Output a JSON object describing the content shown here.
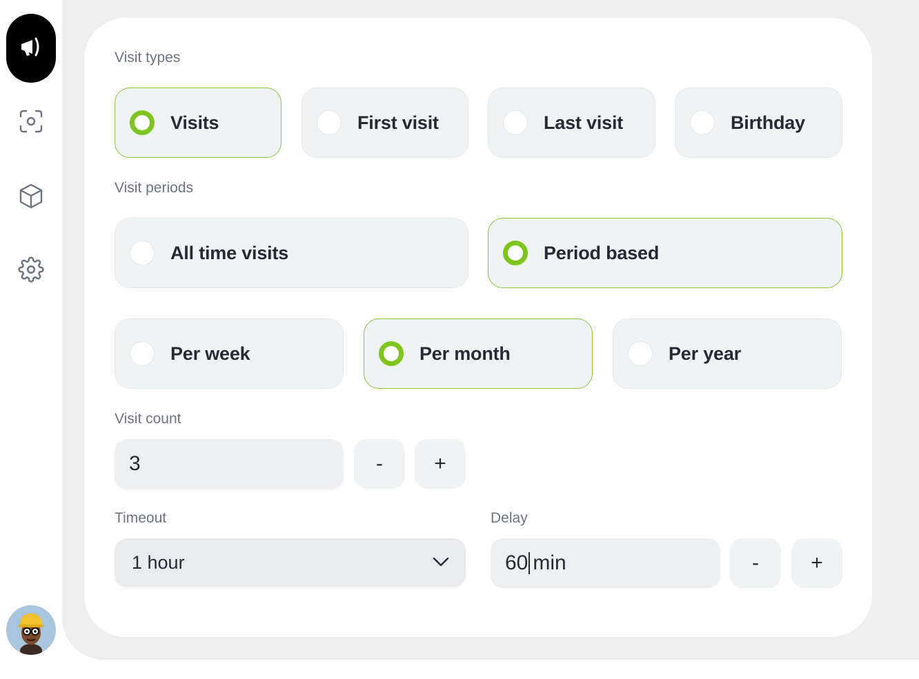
{
  "sidebar": {
    "logo_icon": "megaphone-icon",
    "nav": [
      {
        "icon": "scan-icon"
      },
      {
        "icon": "cube-icon"
      },
      {
        "icon": "gear-icon"
      }
    ],
    "avatar_icon": "user-avatar"
  },
  "visit_types": {
    "label": "Visit types",
    "options": [
      {
        "label": "Visits",
        "selected": true
      },
      {
        "label": "First visit",
        "selected": false
      },
      {
        "label": "Last visit",
        "selected": false
      },
      {
        "label": "Birthday",
        "selected": false
      }
    ]
  },
  "visit_periods": {
    "label": "Visit periods",
    "options": [
      {
        "label": "All time visits",
        "selected": false
      },
      {
        "label": "Period based",
        "selected": true
      }
    ],
    "sub_options": [
      {
        "label": "Per week",
        "selected": false
      },
      {
        "label": "Per month",
        "selected": true
      },
      {
        "label": "Per year",
        "selected": false
      }
    ]
  },
  "visit_count": {
    "label": "Visit count",
    "value": "3",
    "decrement_label": "-",
    "increment_label": "+"
  },
  "timeout": {
    "label": "Timeout",
    "value": "1 hour"
  },
  "delay": {
    "label": "Delay",
    "value": "60",
    "unit": "min",
    "decrement_label": "-",
    "increment_label": "+"
  },
  "colors": {
    "accent": "#7fc51f",
    "option_bg": "#eff3f3"
  }
}
